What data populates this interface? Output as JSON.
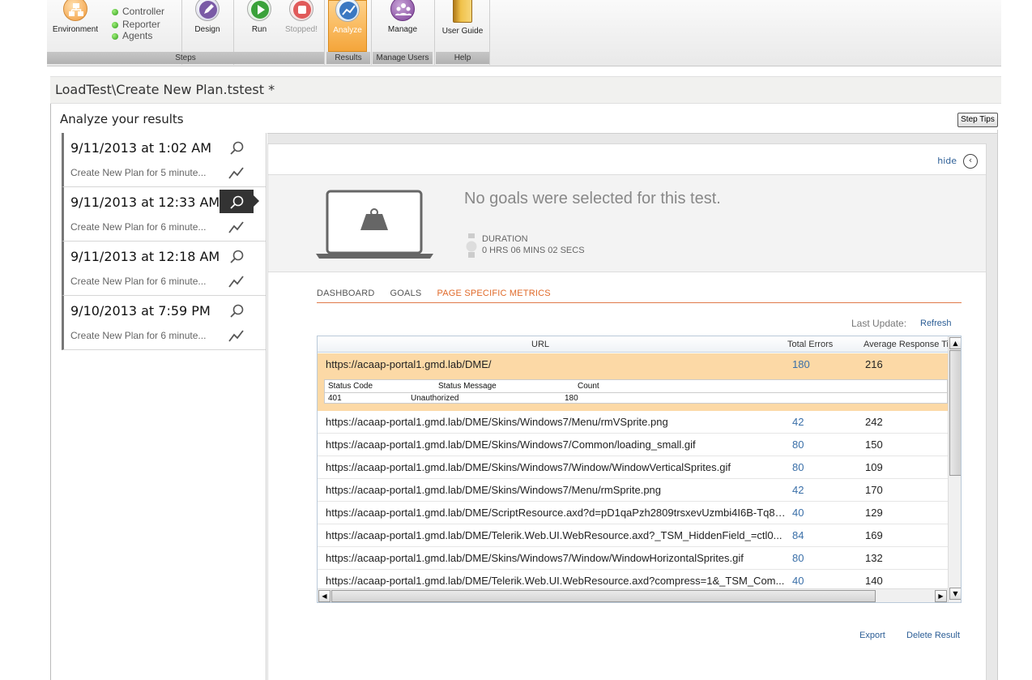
{
  "ribbon": {
    "environment_label": "Environment",
    "status_items": [
      "Controller",
      "Reporter",
      "Agents"
    ],
    "design_label": "Design",
    "run_label": "Run",
    "stopped_label": "Stopped!",
    "analyze_label": "Analyze",
    "manage_label": "Manage",
    "user_guide_label": "User Guide",
    "groups": [
      "Steps",
      "Results",
      "Manage Users",
      "Help"
    ],
    "status_color": "#2f9a1a",
    "active_color": "#f4a53a"
  },
  "path": "LoadTest\\Create New Plan.tstest *",
  "heading": "Analyze your results",
  "step_tips": "Step Tips",
  "runs": [
    {
      "date": "9/11/2013 at 1:02 AM",
      "desc": "Create New Plan for 5 minute..."
    },
    {
      "date": "9/11/2013 at 12:33 AM",
      "desc": "Create New Plan for 6 minute..."
    },
    {
      "date": "9/11/2013 at 12:18 AM",
      "desc": "Create New Plan for 6 minute..."
    },
    {
      "date": "9/10/2013 at 7:59 PM",
      "desc": "Create New Plan for 6 minute..."
    }
  ],
  "panel": {
    "hide": "hide",
    "no_goals": "No goals were selected for this test.",
    "duration_label": "DURATION",
    "duration_value": "0 HRS 06 MINS 02 SECS",
    "tabs": [
      "DASHBOARD",
      "GOALS",
      "PAGE SPECIFIC METRICS"
    ],
    "last_update": "Last Update:",
    "refresh": "Refresh",
    "export": "Export",
    "delete_result": "Delete Result"
  },
  "grid": {
    "headers": [
      "URL",
      "Total Errors",
      "Average Response Tir"
    ],
    "rows": [
      {
        "url": "https://acaap-portal1.gmd.lab/DME/",
        "errors": "180",
        "avg": "216"
      },
      {
        "url": "https://acaap-portal1.gmd.lab/DME/Skins/Windows7/Menu/rmVSprite.png",
        "errors": "42",
        "avg": "242"
      },
      {
        "url": "https://acaap-portal1.gmd.lab/DME/Skins/Windows7/Common/loading_small.gif",
        "errors": "80",
        "avg": "150"
      },
      {
        "url": "https://acaap-portal1.gmd.lab/DME/Skins/Windows7/Window/WindowVerticalSprites.gif",
        "errors": "80",
        "avg": "109"
      },
      {
        "url": "https://acaap-portal1.gmd.lab/DME/Skins/Windows7/Menu/rmSprite.png",
        "errors": "42",
        "avg": "170"
      },
      {
        "url": "https://acaap-portal1.gmd.lab/DME/ScriptResource.axd?d=pD1qaPzh2809trsxevUzmbi4I6B-Tq8S...",
        "errors": "40",
        "avg": "129"
      },
      {
        "url": "https://acaap-portal1.gmd.lab/DME/Telerik.Web.UI.WebResource.axd?_TSM_HiddenField_=ctl0...",
        "errors": "84",
        "avg": "169"
      },
      {
        "url": "https://acaap-portal1.gmd.lab/DME/Skins/Windows7/Window/WindowHorizontalSprites.gif",
        "errors": "80",
        "avg": "132"
      },
      {
        "url": "https://acaap-portal1.gmd.lab/DME/Telerik.Web.UI.WebResource.axd?compress=1&_TSM_Com...",
        "errors": "40",
        "avg": "140"
      }
    ],
    "sub_headers": [
      "Status Code",
      "Status Message",
      "Count"
    ],
    "sub_row": {
      "code": "401",
      "message": "Unauthorized",
      "count": "180"
    },
    "highlight_color": "#fcd9a6"
  },
  "icons": [
    "environment-icon",
    "design-icon",
    "run-icon",
    "stop-icon",
    "analyze-icon",
    "manage-icon",
    "user-guide-icon",
    "magnifier-icon",
    "trend-icon",
    "laptop-weight-icon",
    "stopwatch-icon",
    "hide-arrow-icon"
  ]
}
